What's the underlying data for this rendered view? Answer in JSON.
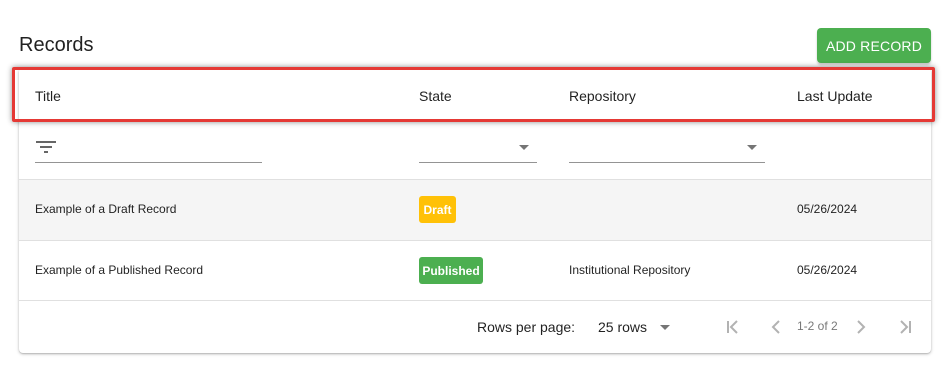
{
  "page": {
    "title": "Records"
  },
  "toolbar": {
    "add_label": "ADD RECORD"
  },
  "table": {
    "headers": {
      "title": "Title",
      "state": "State",
      "repository": "Repository",
      "last_update": "Last Update"
    },
    "rows": [
      {
        "title": "Example of a Draft Record",
        "state": "Draft",
        "repository": "",
        "last_update": "05/26/2024"
      },
      {
        "title": "Example of a Published Record",
        "state": "Published",
        "repository": "Institutional Repository",
        "last_update": "05/26/2024"
      }
    ]
  },
  "pagination": {
    "rows_per_page_label": "Rows per page:",
    "rows_value": "25 rows",
    "range": "1-2 of 2"
  },
  "colors": {
    "accent": "#4caf50",
    "draft": "#ffc107",
    "highlight": "#e53935"
  },
  "icons": {
    "filter": "filter-list-icon",
    "first": "first-page-icon",
    "prev": "chevron-left-icon",
    "next": "chevron-right-icon",
    "last": "last-page-icon"
  }
}
